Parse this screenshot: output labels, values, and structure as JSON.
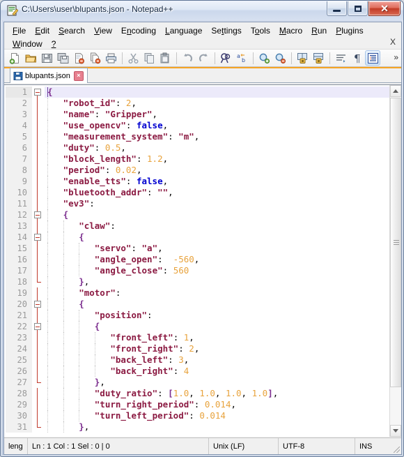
{
  "window": {
    "title": "C:\\Users\\user\\blupants.json - Notepad++",
    "icon": "notepad-plus-plus-icon",
    "controls": {
      "minimize": "–",
      "maximize": "□",
      "close": "✕"
    }
  },
  "menu": {
    "items": [
      {
        "label": "File",
        "accel": "F"
      },
      {
        "label": "Edit",
        "accel": "E"
      },
      {
        "label": "Search",
        "accel": "S"
      },
      {
        "label": "View",
        "accel": "V"
      },
      {
        "label": "Encoding",
        "accel": "n"
      },
      {
        "label": "Language",
        "accel": "L"
      },
      {
        "label": "Settings",
        "accel": "t"
      },
      {
        "label": "Tools",
        "accel": "o"
      },
      {
        "label": "Macro",
        "accel": "M"
      },
      {
        "label": "Run",
        "accel": "R"
      },
      {
        "label": "Plugins",
        "accel": "P"
      },
      {
        "label": "Window",
        "accel": "W"
      },
      {
        "label": "?",
        "accel": "?"
      }
    ],
    "close_x": "X"
  },
  "toolbar": {
    "buttons": [
      "new-file-icon",
      "open-file-icon",
      "save-icon",
      "save-all-icon",
      "close-file-icon",
      "close-all-files-icon",
      "print-icon",
      "cut-icon",
      "copy-icon",
      "paste-icon",
      "undo-icon",
      "redo-icon",
      "find-icon",
      "replace-icon",
      "zoom-in-icon",
      "zoom-out-icon",
      "sync-vertical-scroll-icon",
      "sync-horizontal-scroll-icon",
      "word-wrap-icon",
      "show-all-characters-icon",
      "indent-guide-icon"
    ],
    "overflow": "»"
  },
  "tabs": [
    {
      "label": "blupants.json",
      "icon": "saved-file-icon",
      "close": "×",
      "active": true
    }
  ],
  "editor": {
    "caret_line": 1,
    "lines": [
      {
        "n": 1,
        "fold": "open",
        "indent": 0,
        "tokens": [
          {
            "t": "br",
            "v": "{"
          }
        ]
      },
      {
        "n": 2,
        "indent": 1,
        "tokens": [
          {
            "t": "str",
            "v": "\"robot_id\""
          },
          {
            "t": "op",
            "v": ": "
          },
          {
            "t": "num",
            "v": "2"
          },
          {
            "t": "op",
            "v": ","
          }
        ]
      },
      {
        "n": 3,
        "indent": 1,
        "tokens": [
          {
            "t": "str",
            "v": "\"name\""
          },
          {
            "t": "op",
            "v": ": "
          },
          {
            "t": "str",
            "v": "\"Gripper\""
          },
          {
            "t": "op",
            "v": ","
          }
        ]
      },
      {
        "n": 4,
        "indent": 1,
        "tokens": [
          {
            "t": "str",
            "v": "\"use_opencv\""
          },
          {
            "t": "op",
            "v": ": "
          },
          {
            "t": "kw",
            "v": "false"
          },
          {
            "t": "op",
            "v": ","
          }
        ]
      },
      {
        "n": 5,
        "indent": 1,
        "tokens": [
          {
            "t": "str",
            "v": "\"measurement_system\""
          },
          {
            "t": "op",
            "v": ": "
          },
          {
            "t": "str",
            "v": "\"m\""
          },
          {
            "t": "op",
            "v": ","
          }
        ]
      },
      {
        "n": 6,
        "indent": 1,
        "tokens": [
          {
            "t": "str",
            "v": "\"duty\""
          },
          {
            "t": "op",
            "v": ": "
          },
          {
            "t": "num",
            "v": "0.5"
          },
          {
            "t": "op",
            "v": ","
          }
        ]
      },
      {
        "n": 7,
        "indent": 1,
        "tokens": [
          {
            "t": "str",
            "v": "\"block_length\""
          },
          {
            "t": "op",
            "v": ": "
          },
          {
            "t": "num",
            "v": "1.2"
          },
          {
            "t": "op",
            "v": ","
          }
        ]
      },
      {
        "n": 8,
        "indent": 1,
        "tokens": [
          {
            "t": "str",
            "v": "\"period\""
          },
          {
            "t": "op",
            "v": ": "
          },
          {
            "t": "num",
            "v": "0.02"
          },
          {
            "t": "op",
            "v": ","
          }
        ]
      },
      {
        "n": 9,
        "indent": 1,
        "tokens": [
          {
            "t": "str",
            "v": "\"enable_tts\""
          },
          {
            "t": "op",
            "v": ": "
          },
          {
            "t": "kw",
            "v": "false"
          },
          {
            "t": "op",
            "v": ","
          }
        ]
      },
      {
        "n": 10,
        "indent": 1,
        "tokens": [
          {
            "t": "str",
            "v": "\"bluetooth_addr\""
          },
          {
            "t": "op",
            "v": ": "
          },
          {
            "t": "str",
            "v": "\"\""
          },
          {
            "t": "op",
            "v": ","
          }
        ]
      },
      {
        "n": 11,
        "indent": 1,
        "tokens": [
          {
            "t": "str",
            "v": "\"ev3\""
          },
          {
            "t": "op",
            "v": ":"
          }
        ]
      },
      {
        "n": 12,
        "fold": "open",
        "indent": 1,
        "tokens": [
          {
            "t": "br",
            "v": "{"
          }
        ]
      },
      {
        "n": 13,
        "indent": 2,
        "tokens": [
          {
            "t": "str",
            "v": "\"claw\""
          },
          {
            "t": "op",
            "v": ":"
          }
        ]
      },
      {
        "n": 14,
        "fold": "open",
        "indent": 2,
        "tokens": [
          {
            "t": "br",
            "v": "{"
          }
        ]
      },
      {
        "n": 15,
        "indent": 3,
        "tokens": [
          {
            "t": "str",
            "v": "\"servo\""
          },
          {
            "t": "op",
            "v": ": "
          },
          {
            "t": "str",
            "v": "\"a\""
          },
          {
            "t": "op",
            "v": ","
          }
        ]
      },
      {
        "n": 16,
        "indent": 3,
        "tokens": [
          {
            "t": "str",
            "v": "\"angle_open\""
          },
          {
            "t": "op",
            "v": ":  "
          },
          {
            "t": "num",
            "v": "-560"
          },
          {
            "t": "op",
            "v": ","
          }
        ]
      },
      {
        "n": 17,
        "indent": 3,
        "tokens": [
          {
            "t": "str",
            "v": "\"angle_close\""
          },
          {
            "t": "op",
            "v": ": "
          },
          {
            "t": "num",
            "v": "560"
          }
        ]
      },
      {
        "n": 18,
        "fold": "end",
        "indent": 2,
        "tokens": [
          {
            "t": "br",
            "v": "}"
          },
          {
            "t": "op",
            "v": ","
          }
        ]
      },
      {
        "n": 19,
        "indent": 2,
        "tokens": [
          {
            "t": "str",
            "v": "\"motor\""
          },
          {
            "t": "op",
            "v": ":"
          }
        ]
      },
      {
        "n": 20,
        "fold": "open",
        "indent": 2,
        "tokens": [
          {
            "t": "br",
            "v": "{"
          }
        ]
      },
      {
        "n": 21,
        "indent": 3,
        "tokens": [
          {
            "t": "str",
            "v": "\"position\""
          },
          {
            "t": "op",
            "v": ":"
          }
        ]
      },
      {
        "n": 22,
        "fold": "open",
        "indent": 3,
        "tokens": [
          {
            "t": "br",
            "v": "{"
          }
        ]
      },
      {
        "n": 23,
        "indent": 4,
        "tokens": [
          {
            "t": "str",
            "v": "\"front_left\""
          },
          {
            "t": "op",
            "v": ": "
          },
          {
            "t": "num",
            "v": "1"
          },
          {
            "t": "op",
            "v": ","
          }
        ]
      },
      {
        "n": 24,
        "indent": 4,
        "tokens": [
          {
            "t": "str",
            "v": "\"front_right\""
          },
          {
            "t": "op",
            "v": ": "
          },
          {
            "t": "num",
            "v": "2"
          },
          {
            "t": "op",
            "v": ","
          }
        ]
      },
      {
        "n": 25,
        "indent": 4,
        "tokens": [
          {
            "t": "str",
            "v": "\"back_left\""
          },
          {
            "t": "op",
            "v": ": "
          },
          {
            "t": "num",
            "v": "3"
          },
          {
            "t": "op",
            "v": ","
          }
        ]
      },
      {
        "n": 26,
        "indent": 4,
        "tokens": [
          {
            "t": "str",
            "v": "\"back_right\""
          },
          {
            "t": "op",
            "v": ": "
          },
          {
            "t": "num",
            "v": "4"
          }
        ]
      },
      {
        "n": 27,
        "fold": "end",
        "indent": 3,
        "tokens": [
          {
            "t": "br",
            "v": "}"
          },
          {
            "t": "op",
            "v": ","
          }
        ]
      },
      {
        "n": 28,
        "indent": 3,
        "tokens": [
          {
            "t": "str",
            "v": "\"duty_ratio\""
          },
          {
            "t": "op",
            "v": ": "
          },
          {
            "t": "br",
            "v": "["
          },
          {
            "t": "num",
            "v": "1.0"
          },
          {
            "t": "op",
            "v": ", "
          },
          {
            "t": "num",
            "v": "1.0"
          },
          {
            "t": "op",
            "v": ", "
          },
          {
            "t": "num",
            "v": "1.0"
          },
          {
            "t": "op",
            "v": ", "
          },
          {
            "t": "num",
            "v": "1.0"
          },
          {
            "t": "br",
            "v": "]"
          },
          {
            "t": "op",
            "v": ","
          }
        ]
      },
      {
        "n": 29,
        "indent": 3,
        "tokens": [
          {
            "t": "str",
            "v": "\"turn_right_period\""
          },
          {
            "t": "op",
            "v": ": "
          },
          {
            "t": "num",
            "v": "0.014"
          },
          {
            "t": "op",
            "v": ","
          }
        ]
      },
      {
        "n": 30,
        "indent": 3,
        "tokens": [
          {
            "t": "str",
            "v": "\"turn_left_period\""
          },
          {
            "t": "op",
            "v": ": "
          },
          {
            "t": "num",
            "v": "0.014"
          }
        ]
      },
      {
        "n": 31,
        "fold": "end",
        "indent": 2,
        "tokens": [
          {
            "t": "br",
            "v": "}"
          },
          {
            "t": "op",
            "v": ","
          }
        ]
      }
    ]
  },
  "statusbar": {
    "length_lines": "leng",
    "position": "Ln : 1    Col : 1    Sel : 0 | 0",
    "eol": "Unix (LF)",
    "encoding": "UTF-8",
    "insert_mode": "INS"
  },
  "colors": {
    "string": "#8b1a42",
    "number": "#e8a33d",
    "keyword": "#0000d0",
    "bracket": "#7b2d8e",
    "fold_line": "#c0392b",
    "tab_accent": "#f6a424",
    "current_line": "#eceafa"
  }
}
